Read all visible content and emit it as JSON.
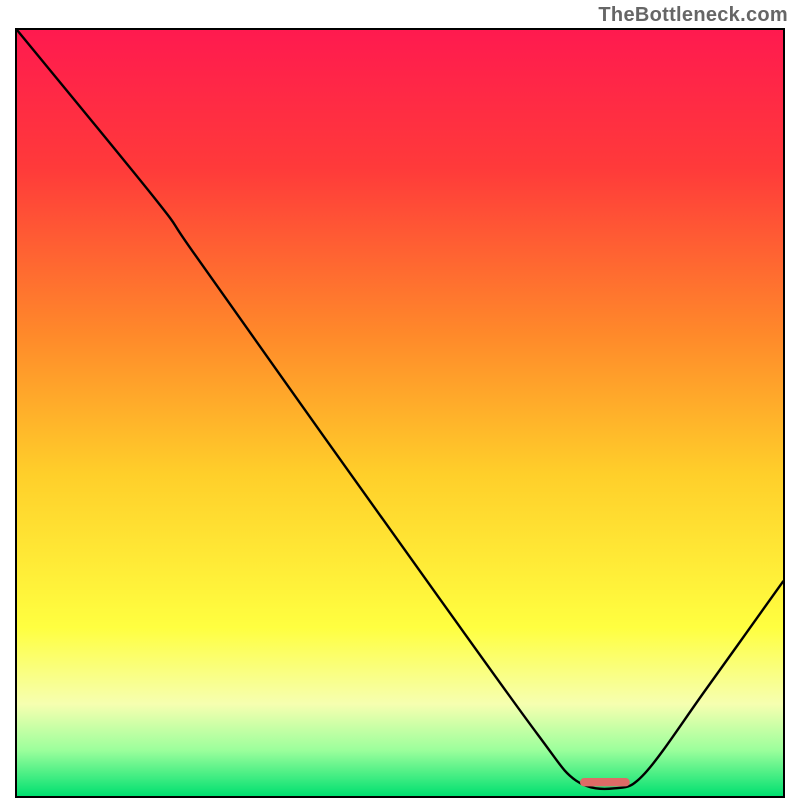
{
  "watermark": "TheBottleneck.com",
  "chart_data": {
    "type": "line",
    "title": "",
    "xlabel": "",
    "ylabel": "",
    "xlim": [
      0,
      100
    ],
    "ylim": [
      0,
      100
    ],
    "background": {
      "type": "vertical-gradient",
      "stops": [
        {
          "offset": 0.0,
          "color": "#ff1a4f"
        },
        {
          "offset": 0.18,
          "color": "#ff3a3a"
        },
        {
          "offset": 0.4,
          "color": "#ff8a2a"
        },
        {
          "offset": 0.58,
          "color": "#ffcf2a"
        },
        {
          "offset": 0.78,
          "color": "#ffff40"
        },
        {
          "offset": 0.88,
          "color": "#f6ffb0"
        },
        {
          "offset": 0.94,
          "color": "#9cff9c"
        },
        {
          "offset": 1.0,
          "color": "#00e070"
        }
      ]
    },
    "series": [
      {
        "name": "bottleneck-curve",
        "color": "#000000",
        "smoothing": "cubic",
        "points": [
          {
            "x": 0,
            "y": 100
          },
          {
            "x": 18,
            "y": 78
          },
          {
            "x": 23,
            "y": 71
          },
          {
            "x": 40,
            "y": 47
          },
          {
            "x": 55,
            "y": 26
          },
          {
            "x": 68,
            "y": 8
          },
          {
            "x": 73,
            "y": 2
          },
          {
            "x": 78,
            "y": 1
          },
          {
            "x": 82,
            "y": 3
          },
          {
            "x": 90,
            "y": 14
          },
          {
            "x": 100,
            "y": 28
          }
        ]
      }
    ],
    "marker": {
      "name": "optimal-range",
      "x_start": 73.5,
      "x_end": 80,
      "y": 1.8,
      "color": "#dd6b66",
      "thickness_pct": 1.1
    }
  }
}
